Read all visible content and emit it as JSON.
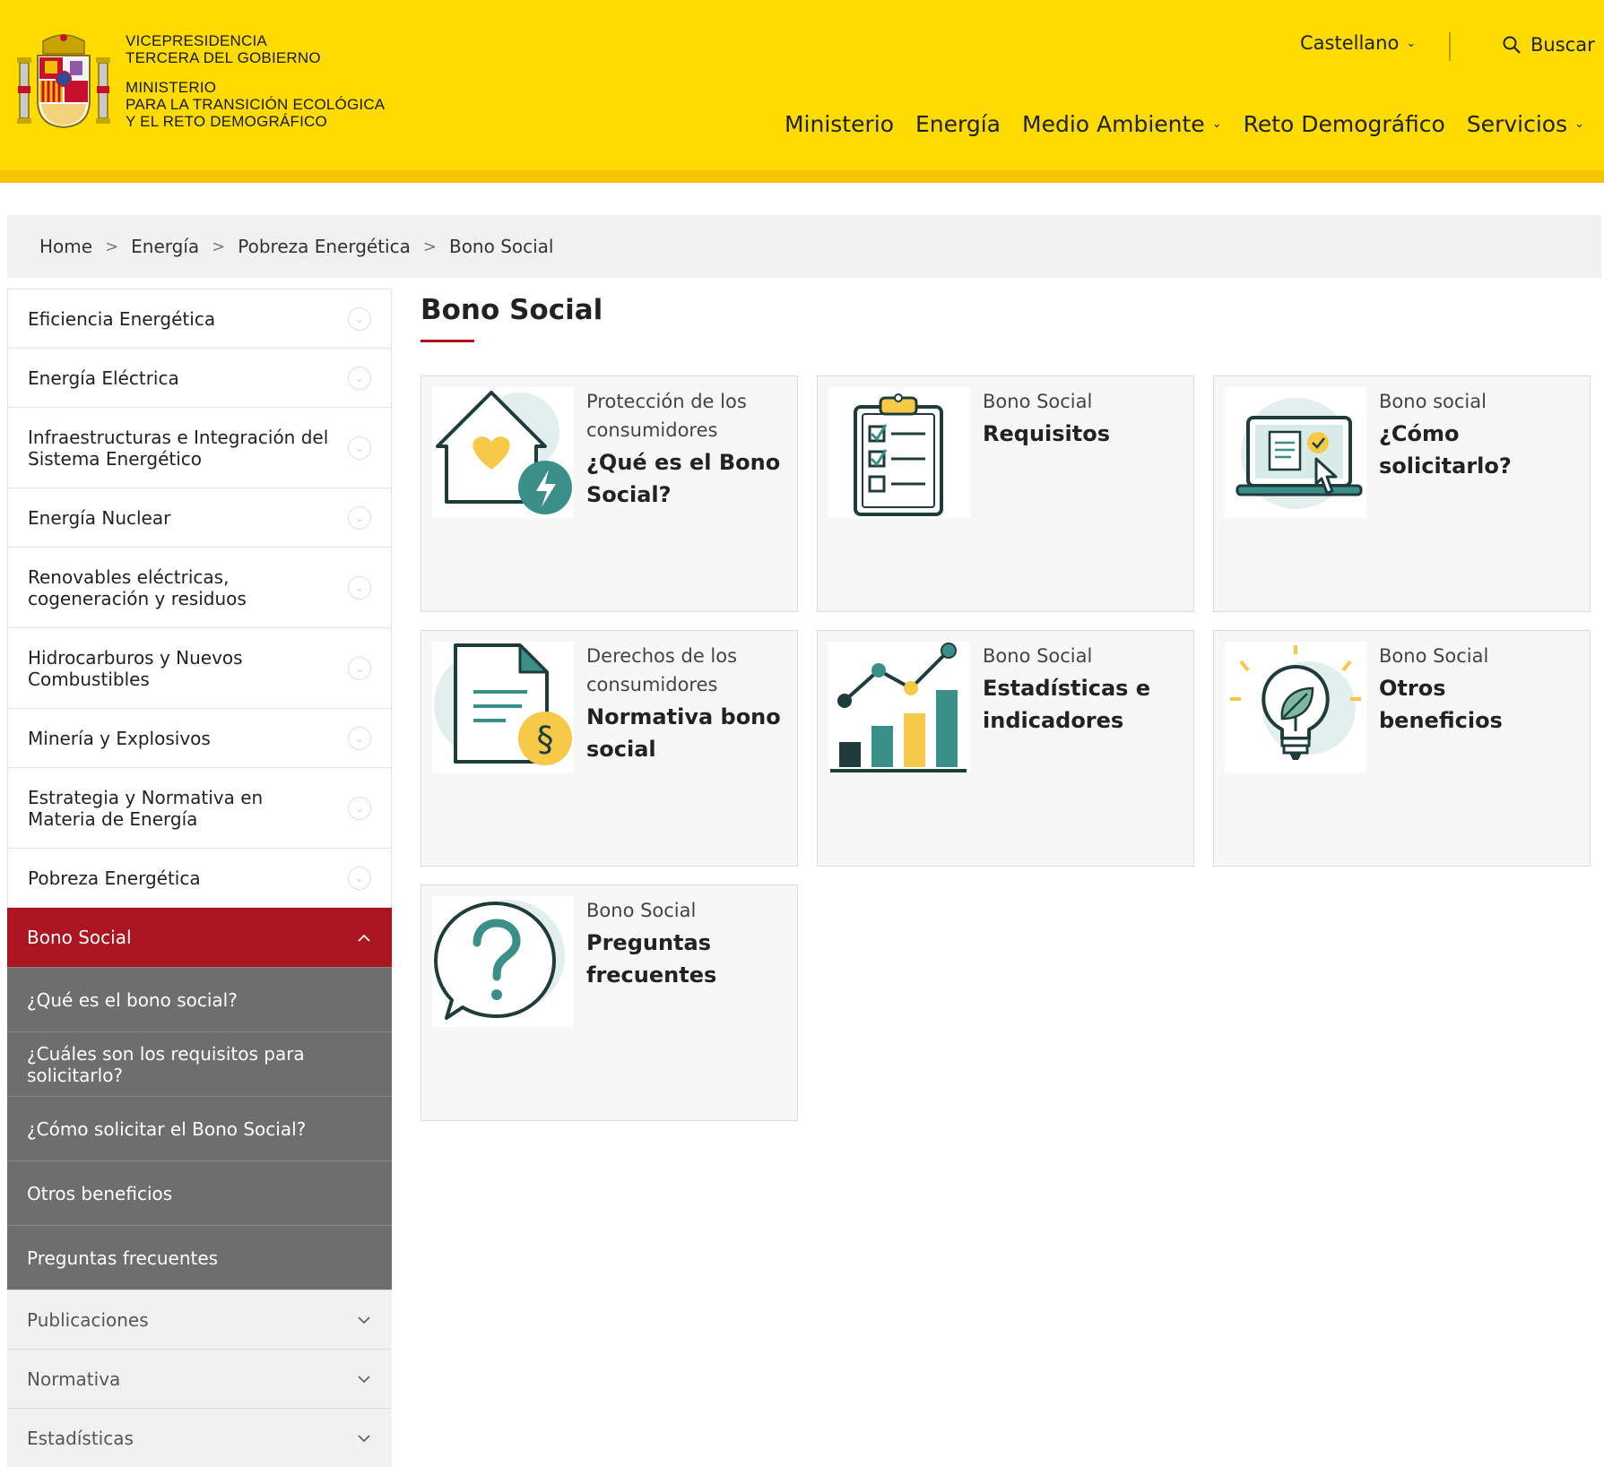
{
  "header": {
    "gov_line1": "VICEPRESIDENCIA",
    "gov_line2": "TERCERA DEL GOBIERNO",
    "gov_line3": "MINISTERIO",
    "gov_line4": "PARA LA TRANSICIÓN ECOLÓGICA",
    "gov_line5": "Y EL RETO DEMOGRÁFICO",
    "language": "Castellano",
    "search_label": "Buscar",
    "nav": [
      "Ministerio",
      "Energía",
      "Medio Ambiente",
      "Reto Demográfico",
      "Servicios"
    ]
  },
  "breadcrumb": [
    "Home",
    "Energía",
    "Pobreza Energética",
    "Bono Social"
  ],
  "breadcrumb_separator": ">",
  "sidebar": {
    "items": [
      "Eficiencia Energética",
      "Energía Eléctrica",
      "Infraestructuras e Integración del Sistema Energético",
      "Energía Nuclear",
      "Renovables eléctricas, cogeneración y residuos",
      "Hidrocarburos y Nuevos Combustibles",
      "Minería y Explosivos",
      "Estrategia y Normativa en Materia de Energía",
      "Pobreza Energética"
    ],
    "active": "Bono Social",
    "subitems": [
      "¿Qué es el bono social?",
      "¿Cuáles son los requisitos para solicitarlo?",
      "¿Cómo solicitar el Bono Social?",
      "Otros beneficios",
      "Preguntas frecuentes"
    ],
    "bottom_items": [
      "Publicaciones",
      "Normativa",
      "Estadísticas"
    ]
  },
  "main": {
    "title": "Bono Social",
    "cards": [
      {
        "category": "Protección de los consumidores",
        "title": "¿Qué es el Bono Social?",
        "icon": "house-heart-energy-icon"
      },
      {
        "category": "Bono Social",
        "title": "Requisitos",
        "icon": "clipboard-checklist-icon"
      },
      {
        "category": "Bono social",
        "title": "¿Cómo solicitarlo?",
        "icon": "laptop-click-icon"
      },
      {
        "category": "Derechos de los consumidores",
        "title": "Normativa bono social",
        "icon": "document-section-icon"
      },
      {
        "category": "Bono Social",
        "title": "Estadísticas e indicadores",
        "icon": "bar-chart-trend-icon"
      },
      {
        "category": "Bono Social",
        "title": "Otros beneficios",
        "icon": "lightbulb-leaf-icon"
      },
      {
        "category": "Bono Social",
        "title": "Preguntas frecuentes",
        "icon": "question-bubble-icon"
      }
    ]
  },
  "colors": {
    "header_yellow": "#FFDB00",
    "active_red": "#AB1520",
    "sub_grey": "#6e6e6e",
    "icon_teal": "#3a8f88",
    "icon_yellow": "#F7C948"
  }
}
